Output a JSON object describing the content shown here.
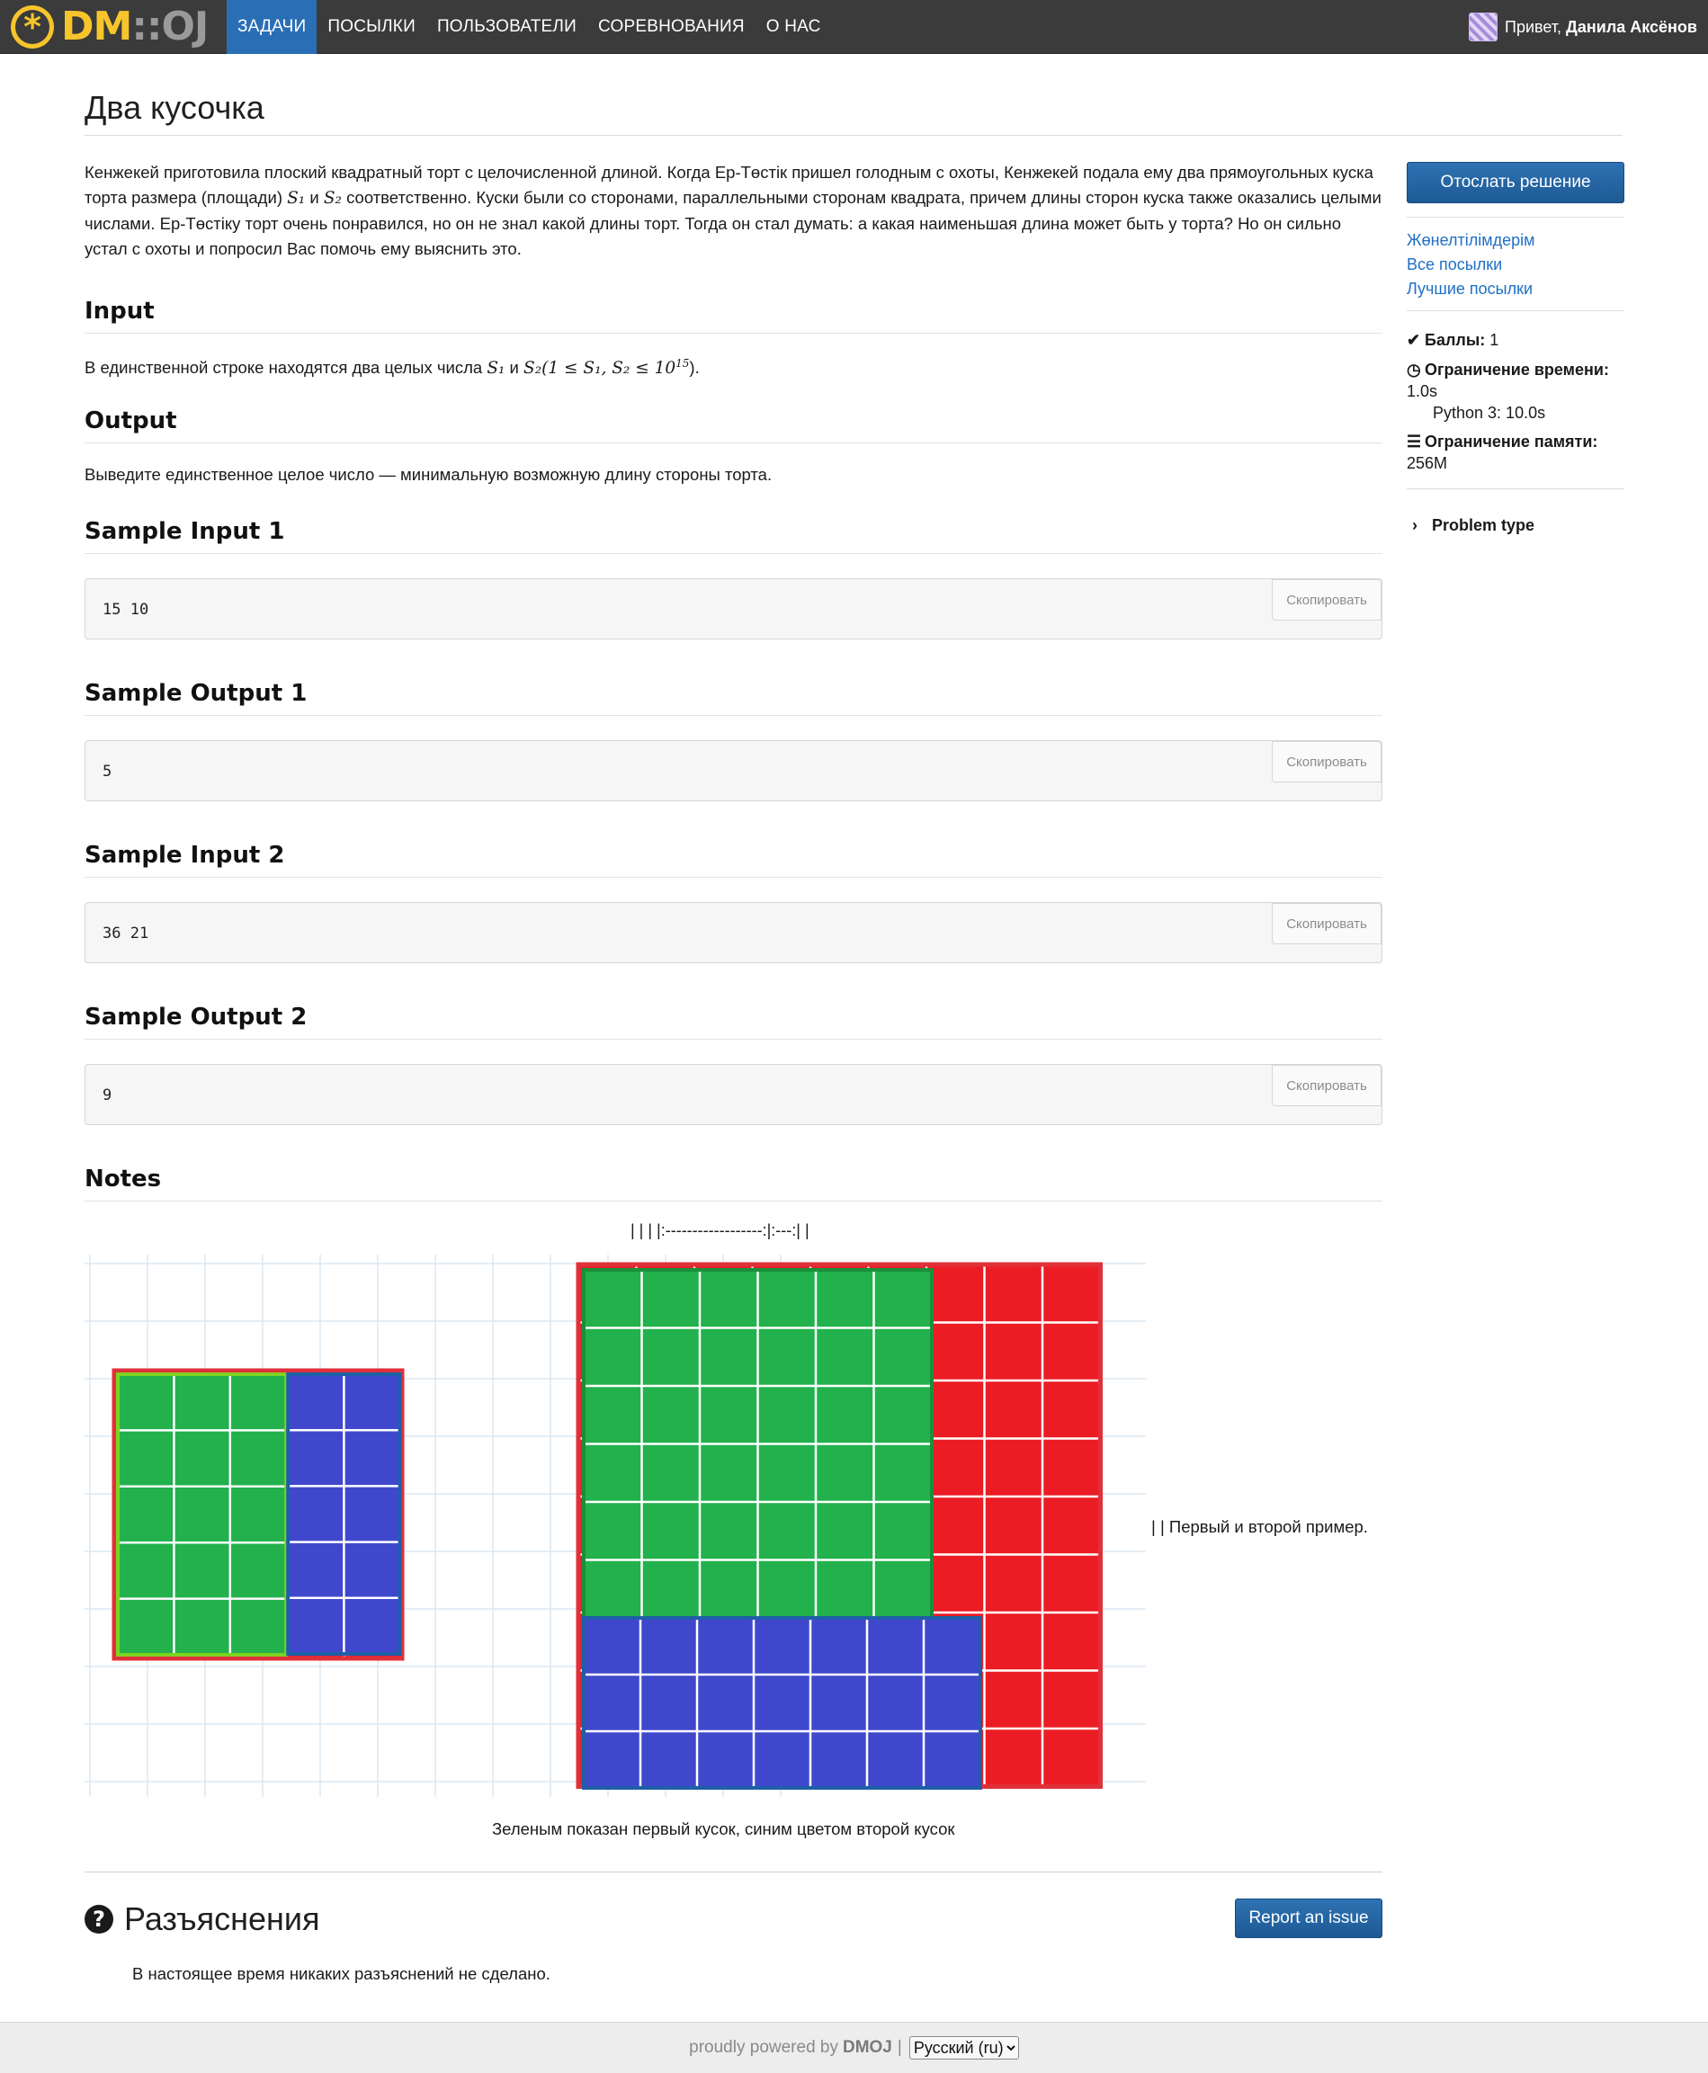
{
  "navbar": {
    "logo_text": "DM",
    "logo_dots": "::",
    "logo_oj": "OJ",
    "items": [
      {
        "label": "ЗАДАЧИ",
        "active": true
      },
      {
        "label": "ПОСЫЛКИ"
      },
      {
        "label": "ПОЛЬЗОВАТЕЛИ"
      },
      {
        "label": "СОРЕВНОВАНИЯ"
      },
      {
        "label": "О НАС"
      }
    ],
    "greeting": "Привет,",
    "user_name": "Данила Аксёнов"
  },
  "problem": {
    "title": "Два кусочка",
    "statement_parts": [
      "Кенжекей приготовила плоский квадратный торт с целочисленной длиной. Когда Ер-Төстік пришел голодным с охоты, Кенжекей подала ему два прямоугольных куска торта размера (площади) ",
      "S₁",
      " и ",
      "S₂",
      " соответственно. Куски были со сторонами, параллельными сторонам квадрата, причем длины сторон куска также оказались целыми числами. Ер-Төстіку торт очень понравился, но он не знал какой длины торт. Тогда он стал думать: а какая наименьшая длина может быть у торта? Но он сильно устал с охоты и попросил Вас помочь ему выяснить это."
    ],
    "input_heading": "Input",
    "input_parts": [
      "В единственной строке находятся два целых числа ",
      "S₁",
      " и ",
      "S₂",
      "(1 ≤ S₁, S₂ ≤ 10",
      "15",
      ")."
    ],
    "output_heading": "Output",
    "output_text": "Выведите единственное целое число — минимальную возможную длину стороны торта.",
    "samples": [
      {
        "heading": "Sample Input 1",
        "value": "15 10"
      },
      {
        "heading": "Sample Output 1",
        "value": "5"
      },
      {
        "heading": "Sample Input 2",
        "value": "36 21"
      },
      {
        "heading": "Sample Output 2",
        "value": "9"
      }
    ],
    "copy_label": "Скопировать",
    "notes_heading": "Notes",
    "table_markup_line": "| | | |:------------------:|:---:| |",
    "figure_caption_side": "| | Первый и второй пример.",
    "figure_caption": "Зеленым показан первый кусок, синим цветом второй кусок"
  },
  "sidebar": {
    "submit_label": "Отослать решение",
    "links": [
      "Жөнелтілімдерім",
      "Все посылки",
      "Лучшие посылки"
    ],
    "points_label": "Баллы:",
    "points_value": "1",
    "time_label": "Ограничение времени:",
    "time_value": "1.0s",
    "time_python": "Python 3: 10.0s",
    "memory_label": "Ограничение памяти:",
    "memory_value": "256M",
    "problem_type_label": "Problem type"
  },
  "clarifications": {
    "title": "Разъяснения",
    "report_label": "Report an issue",
    "text": "В настоящее время никаких разъяснений не сделано."
  },
  "footer": {
    "powered_text": "proudly powered by",
    "powered_brand": "DMOJ",
    "separator": "|",
    "language": "Русский (ru)"
  },
  "colors": {
    "navbar_bg": "#3b3b3b",
    "nav_active": "#2a6fb6",
    "link": "#1f6fc5",
    "button": "#2366a8",
    "cake_red": "#ec1c24",
    "piece_green": "#22b14c",
    "piece_blue": "#3f48cc"
  },
  "figure": {
    "example1": {
      "cake_side": 5,
      "green": [
        3,
        5
      ],
      "blue": [
        2,
        5
      ]
    },
    "example2": {
      "cake_side": 9,
      "green": [
        6,
        6
      ],
      "blue": [
        7,
        3
      ]
    }
  }
}
